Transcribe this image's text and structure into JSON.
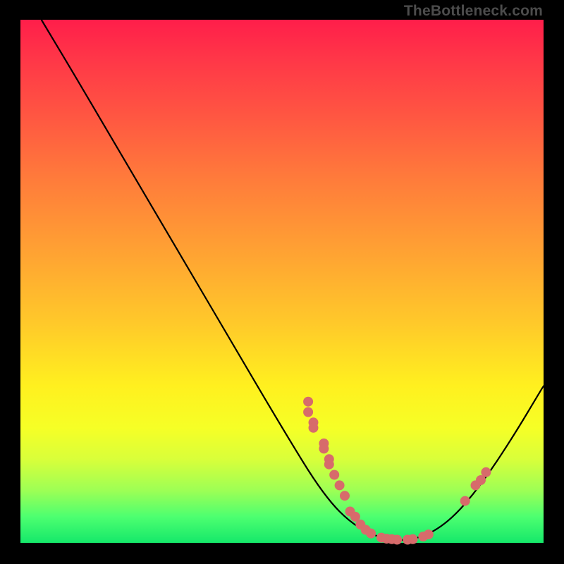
{
  "watermark": "TheBottleneck.com",
  "chart_data": {
    "type": "line",
    "title": "",
    "xlabel": "",
    "ylabel": "",
    "xlim": [
      0,
      100
    ],
    "ylim": [
      0,
      100
    ],
    "curve": [
      {
        "x": 4,
        "y": 100
      },
      {
        "x": 10,
        "y": 90
      },
      {
        "x": 20,
        "y": 73
      },
      {
        "x": 30,
        "y": 56
      },
      {
        "x": 40,
        "y": 39
      },
      {
        "x": 50,
        "y": 22
      },
      {
        "x": 58,
        "y": 9
      },
      {
        "x": 64,
        "y": 3
      },
      {
        "x": 70,
        "y": 0.5
      },
      {
        "x": 76,
        "y": 0.6
      },
      {
        "x": 82,
        "y": 4
      },
      {
        "x": 88,
        "y": 11
      },
      {
        "x": 94,
        "y": 20
      },
      {
        "x": 100,
        "y": 30
      }
    ],
    "points": [
      {
        "x": 55,
        "y": 27
      },
      {
        "x": 55,
        "y": 25
      },
      {
        "x": 56,
        "y": 23
      },
      {
        "x": 56,
        "y": 22
      },
      {
        "x": 58,
        "y": 19
      },
      {
        "x": 58,
        "y": 18
      },
      {
        "x": 59,
        "y": 16
      },
      {
        "x": 59,
        "y": 15
      },
      {
        "x": 60,
        "y": 13
      },
      {
        "x": 61,
        "y": 11
      },
      {
        "x": 62,
        "y": 9
      },
      {
        "x": 63,
        "y": 6
      },
      {
        "x": 64,
        "y": 5
      },
      {
        "x": 65,
        "y": 3.5
      },
      {
        "x": 66,
        "y": 2.5
      },
      {
        "x": 67,
        "y": 1.8
      },
      {
        "x": 69,
        "y": 1
      },
      {
        "x": 70,
        "y": 0.8
      },
      {
        "x": 71,
        "y": 0.7
      },
      {
        "x": 72,
        "y": 0.6
      },
      {
        "x": 74,
        "y": 0.6
      },
      {
        "x": 75,
        "y": 0.7
      },
      {
        "x": 77,
        "y": 1.2
      },
      {
        "x": 78,
        "y": 1.6
      },
      {
        "x": 85,
        "y": 8
      },
      {
        "x": 87,
        "y": 11
      },
      {
        "x": 88,
        "y": 12
      },
      {
        "x": 89,
        "y": 13.5
      }
    ],
    "gradient_stops": [
      {
        "pos": 0,
        "color": "#ff1e4a"
      },
      {
        "pos": 18,
        "color": "#ff5542"
      },
      {
        "pos": 44,
        "color": "#ffa133"
      },
      {
        "pos": 70,
        "color": "#fff01f"
      },
      {
        "pos": 90,
        "color": "#9dff55"
      },
      {
        "pos": 100,
        "color": "#15e86a"
      }
    ]
  }
}
